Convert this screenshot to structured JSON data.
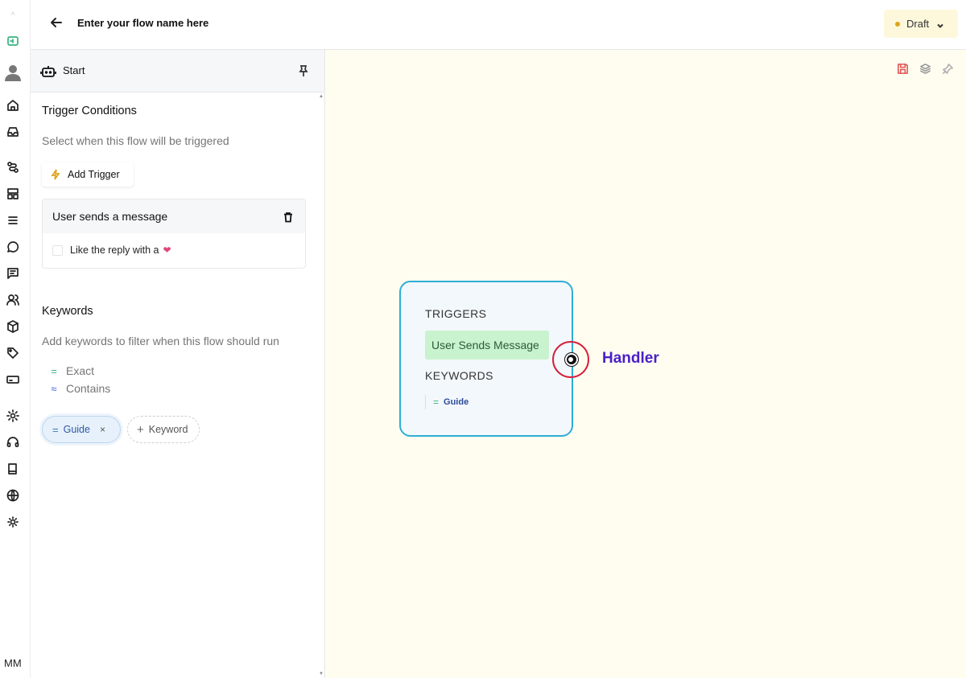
{
  "rail": {
    "initials": "MM",
    "icons": [
      "app-logo",
      "flow-builder-icon",
      "avatar",
      "home-icon",
      "inbox-icon",
      "integrations-icon",
      "layout-icon",
      "list-icon",
      "chat-icon",
      "messages-icon",
      "contacts-icon",
      "package-icon",
      "tag-icon",
      "card-icon",
      "settings-icon",
      "support-icon",
      "book-icon",
      "globe-icon",
      "theme-icon"
    ]
  },
  "header": {
    "flow_name": "Enter your flow name here",
    "status": "Draft"
  },
  "panel": {
    "node_title": "Start",
    "trigger_section": {
      "title": "Trigger Conditions",
      "description": "Select when this flow will be triggered",
      "add_button": "Add Trigger"
    },
    "trigger_card": {
      "title": "User sends a message",
      "option_label": "Like the reply with a",
      "option_checked": false
    },
    "keywords_section": {
      "title": "Keywords",
      "description": "Add keywords to filter when this flow should run",
      "match_types": [
        {
          "symbol": "=",
          "label": "Exact"
        },
        {
          "symbol": "≈",
          "label": "Contains"
        }
      ],
      "chips": [
        {
          "symbol": "=",
          "label": "Guide",
          "remove": "×"
        }
      ],
      "add_keyword": "Keyword"
    }
  },
  "canvas": {
    "node": {
      "triggers_label": "TRIGGERS",
      "trigger_value": "User Sends Message",
      "keywords_label": "KEYWORDS",
      "keyword_value": "Guide"
    },
    "handler_label": "Handler"
  },
  "colors": {
    "accent_green": "#36b37e",
    "node_border": "#2eaed6",
    "annotation_red": "#d81f3a",
    "annotation_text": "#4a20c8",
    "draft_dot": "#e0a41b"
  }
}
